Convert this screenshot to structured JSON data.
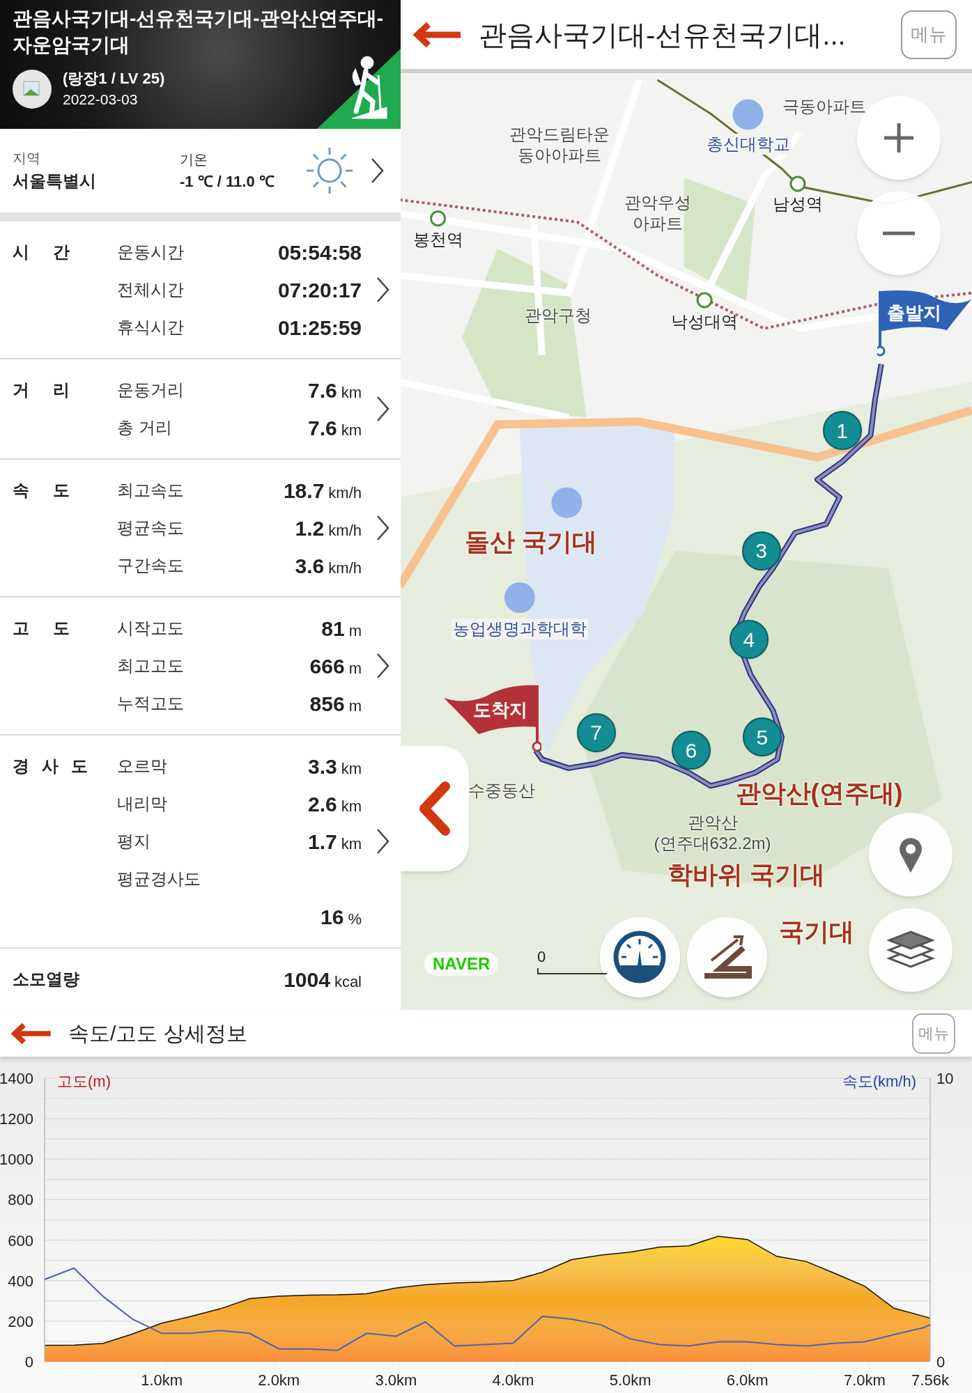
{
  "profile": {
    "title": "관음사국기대-선유천국기대-관악산연주대-자운암국기대",
    "user": "(랑장1 / LV 25)",
    "date": "2022-03-03"
  },
  "weather": {
    "region_label": "지역",
    "region": "서울특별시",
    "temp_label": "기온",
    "temperature": "-1 ℃ / 11.0 ℃"
  },
  "sections": [
    {
      "title": "시 간",
      "rows": [
        {
          "label": "운동시간",
          "value": "05:54:58",
          "kind": "inline"
        },
        {
          "label": "전체시간",
          "value": "07:20:17",
          "kind": "inline"
        },
        {
          "label": "휴식시간",
          "value": "01:25:59",
          "kind": "inline"
        }
      ]
    },
    {
      "title": "거 리",
      "rows": [
        {
          "label": "운동거리",
          "value": "7.6",
          "unit": "km",
          "kind": "inline"
        },
        {
          "label": "총 거리",
          "value": "7.6",
          "unit": "km",
          "kind": "inline"
        }
      ]
    },
    {
      "title": "속 도",
      "rows": [
        {
          "label": "최고속도",
          "value": "18.7",
          "unit": "km/h",
          "kind": "inline"
        },
        {
          "label": "평균속도",
          "value": "1.2",
          "unit": "km/h",
          "kind": "inline"
        },
        {
          "label": "구간속도",
          "value": "3.6",
          "unit": "km/h",
          "kind": "inline"
        }
      ]
    },
    {
      "title": "고 도",
      "rows": [
        {
          "label": "시작고도",
          "value": "81",
          "unit": "m",
          "kind": "inline"
        },
        {
          "label": "최고고도",
          "value": "666",
          "unit": "m",
          "kind": "inline"
        },
        {
          "label": "누적고도",
          "value": "856",
          "unit": "m",
          "kind": "inline"
        }
      ]
    },
    {
      "title": "경 사 도",
      "rows": [
        {
          "label": "오르막",
          "value": "3.3",
          "unit": "km",
          "kind": "inline"
        },
        {
          "label": "내리막",
          "value": "2.6",
          "unit": "km",
          "kind": "inline"
        },
        {
          "label": "평지",
          "value": "1.7",
          "unit": "km",
          "kind": "inline"
        },
        {
          "label": "평균경사도",
          "value": "16",
          "unit": "%",
          "kind": "below"
        }
      ]
    }
  ],
  "calories": {
    "label": "소모열량",
    "value": "1004",
    "unit": "kcal"
  },
  "map_header": {
    "title": "관음사국기대-선유천국기대...",
    "menu": "메뉴"
  },
  "map": {
    "start_flag": "출발지",
    "end_flag": "도착지",
    "waypoints": [
      "1",
      "3",
      "4",
      "5",
      "6",
      "7"
    ],
    "poi_labels": [
      "돌산 국기대",
      "관악산(연주대)",
      "학바위 국기대",
      "국기대"
    ],
    "place_labels": [
      {
        "text": "관악드림타운\n동아아파트",
        "kind": "place"
      },
      {
        "text": "총신대학교",
        "kind": "school"
      },
      {
        "text": "극동아파트",
        "kind": "place"
      },
      {
        "text": "관악우성\n아파트",
        "kind": "place"
      },
      {
        "text": "남성역",
        "kind": "station"
      },
      {
        "text": "봉천역",
        "kind": "station"
      },
      {
        "text": "관악구청",
        "kind": "place"
      },
      {
        "text": "낙성대역",
        "kind": "station"
      },
      {
        "text": "농업생명과학대학",
        "kind": "school"
      },
      {
        "text": "수중동산",
        "kind": "place"
      },
      {
        "text": "관악산\n(연주대632.2m)",
        "kind": "place"
      }
    ],
    "attribution": "NAVER",
    "scale": "0"
  },
  "detail_header": {
    "title": "속도/고도 상세정보",
    "menu": "메뉴"
  },
  "elevation_chart": {
    "chart_data": {
      "type": "area",
      "x": [
        0,
        0.25,
        0.5,
        0.75,
        1,
        1.25,
        1.5,
        1.75,
        2,
        2.25,
        2.5,
        2.75,
        3,
        3.25,
        3.5,
        3.75,
        4,
        4.25,
        4.5,
        4.75,
        5,
        5.25,
        5.5,
        5.75,
        6,
        6.25,
        6.5,
        6.75,
        7,
        7.25,
        7.5,
        7.56
      ],
      "series": [
        {
          "name": "고도(m)",
          "color": "#f5a623",
          "values": [
            81,
            82,
            90,
            137,
            190,
            224,
            261,
            311,
            323,
            328,
            330,
            335,
            364,
            380,
            389,
            393,
            401,
            442,
            504,
            526,
            541,
            566,
            572,
            619,
            603,
            520,
            495,
            435,
            373,
            264,
            225,
            215
          ]
        }
      ],
      "xlim": [
        0,
        7.56
      ],
      "ylim": [
        0,
        1400
      ],
      "xticks": [
        {
          "value": 1,
          "label": "1.0km"
        },
        {
          "value": 2,
          "label": "2.0km"
        },
        {
          "value": 3,
          "label": "3.0km"
        },
        {
          "value": 4,
          "label": "4.0km"
        },
        {
          "value": 5,
          "label": "5.0km"
        },
        {
          "value": 6,
          "label": "6.0km"
        },
        {
          "value": 7,
          "label": "7.0km"
        },
        {
          "value": 7.56,
          "label": "7.56k"
        }
      ],
      "yticks": [
        0,
        200,
        400,
        600,
        800,
        1000,
        1200,
        1400
      ],
      "grid": true
    }
  },
  "speed_chart": {
    "chart_data": {
      "type": "line",
      "x": [
        0,
        0.25,
        0.5,
        0.75,
        1,
        1.25,
        1.5,
        1.75,
        2,
        2.25,
        2.5,
        2.75,
        3,
        3.25,
        3.5,
        3.75,
        4,
        4.25,
        4.5,
        4.75,
        5,
        5.25,
        5.5,
        5.75,
        6,
        6.25,
        6.5,
        6.75,
        7,
        7.25,
        7.5,
        7.56
      ],
      "series": [
        {
          "name": "속도(km/h)",
          "color": "#4a64b0",
          "values": [
            2.9,
            3.3,
            2.3,
            1.5,
            1.0,
            1.0,
            1.1,
            1.0,
            0.45,
            0.45,
            0.4,
            1.0,
            0.9,
            1.4,
            0.55,
            0.6,
            0.65,
            1.6,
            1.5,
            1.3,
            0.8,
            0.6,
            0.55,
            0.7,
            0.7,
            0.6,
            0.55,
            0.65,
            0.7,
            0.95,
            1.2,
            1.3
          ]
        }
      ],
      "xlim": [
        0,
        7.56
      ],
      "ylim": [
        0,
        10
      ],
      "yticks": [
        0,
        10
      ]
    }
  }
}
